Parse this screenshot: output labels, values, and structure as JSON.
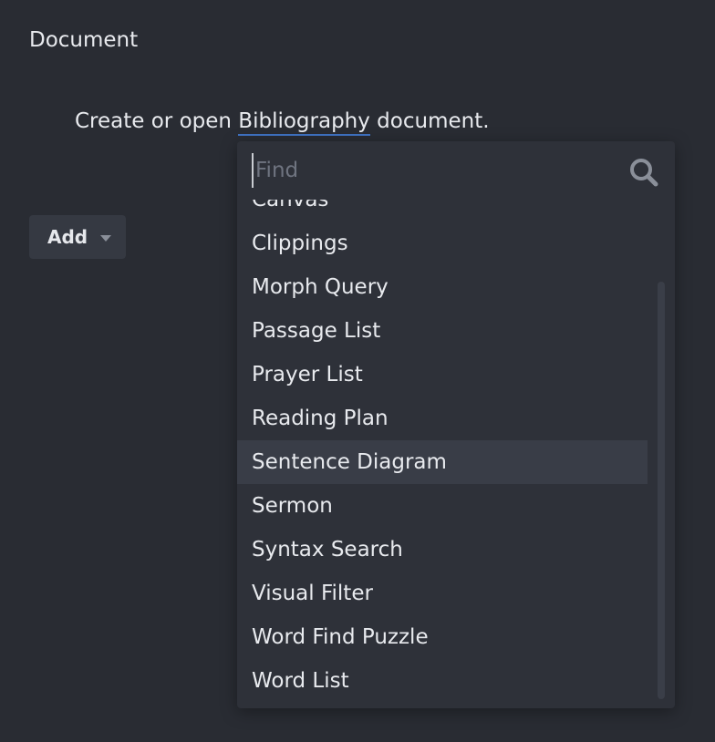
{
  "section": {
    "title": "Document"
  },
  "prompt": {
    "before": "Create or open ",
    "link": "Bibliography",
    "after": " document."
  },
  "add_button": {
    "label": "Add"
  },
  "dropdown": {
    "search_placeholder": "Find",
    "items": [
      "Canvas",
      "Clippings",
      "Morph Query",
      "Passage List",
      "Prayer List",
      "Reading Plan",
      "Sentence Diagram",
      "Sermon",
      "Syntax Search",
      "Visual Filter",
      "Word Find Puzzle",
      "Word List"
    ],
    "highlighted_item": "Sentence Diagram"
  },
  "icons": {
    "search": "search-icon",
    "add_caret": "caret-down-icon"
  },
  "colors": {
    "background": "#292c33",
    "panel": "#2e3139",
    "highlight": "#393d47",
    "link_underline": "#3f72c2"
  }
}
